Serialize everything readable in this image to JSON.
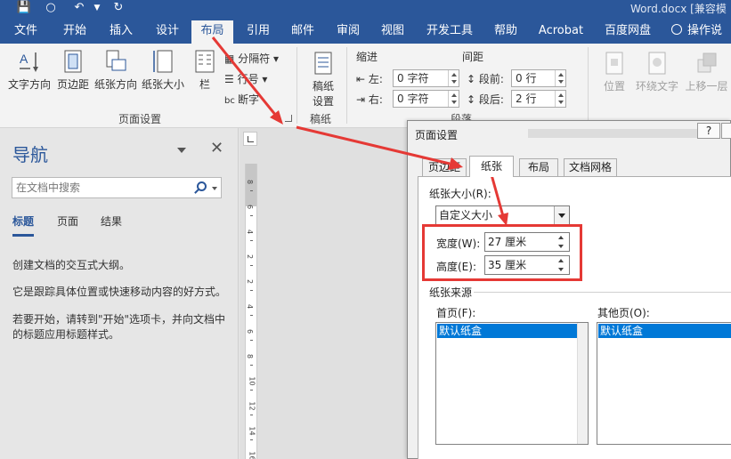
{
  "titlebar": {
    "doc_title": "Word.docx [兼容模"
  },
  "tabs": [
    {
      "label": "文件"
    },
    {
      "label": "开始"
    },
    {
      "label": "插入"
    },
    {
      "label": "设计"
    },
    {
      "label": "布局"
    },
    {
      "label": "引用"
    },
    {
      "label": "邮件"
    },
    {
      "label": "审阅"
    },
    {
      "label": "视图"
    },
    {
      "label": "开发工具"
    },
    {
      "label": "帮助"
    },
    {
      "label": "Acrobat"
    },
    {
      "label": "百度网盘"
    },
    {
      "label": "操作说明"
    }
  ],
  "ribbon": {
    "page_setup": {
      "text_direction": "文字方向",
      "margins": "页边距",
      "orientation": "纸张方向",
      "size": "纸张大小",
      "columns": "栏",
      "breaks": "分隔符",
      "line_numbers": "行号",
      "hyphenation": "断字",
      "group_label": "页面设置"
    },
    "draft": {
      "draft_setup_1": "稿纸",
      "draft_setup_2": "设置",
      "group_label": "稿纸"
    },
    "paragraph": {
      "indent_label": "缩进",
      "spacing_label": "间距",
      "left": "左:",
      "right": "右:",
      "left_value": "0 字符",
      "right_value": "0 字符",
      "before": "段前:",
      "after": "段后:",
      "before_value": "0 行",
      "after_value": "2 行",
      "group_label": "段落"
    },
    "arrange": {
      "position": "位置",
      "wrap_text": "环绕文字",
      "bring_forward": "上移一层"
    }
  },
  "nav": {
    "title": "导航",
    "search_placeholder": "在文档中搜索",
    "tabs": [
      "标题",
      "页面",
      "结果"
    ],
    "text1": "创建文档的交互式大纲。",
    "text2": "它是跟踪具体位置或快速移动内容的好方式。",
    "text3": "若要开始，请转到\"开始\"选项卡，并向文档中的标题应用标题样式。"
  },
  "ruler": {
    "numbers": [
      "8",
      "6",
      "4",
      "2",
      "2",
      "4",
      "6",
      "8",
      "10",
      "12",
      "14",
      "16"
    ]
  },
  "dialog": {
    "title": "页面设置",
    "help": "?",
    "tabs": [
      "页边距",
      "纸张",
      "布局",
      "文档网格"
    ],
    "paper_size_label": "纸张大小(R):",
    "paper_size_value": "自定义大小",
    "width_label": "宽度(W):",
    "width_value": "27 厘米",
    "height_label": "高度(E):",
    "height_value": "35 厘米",
    "paper_source_label": "纸张来源",
    "first_page_label": "首页(F):",
    "other_pages_label": "其他页(O):",
    "first_page_selected": "默认纸盒",
    "other_pages_selected": "默认纸盒"
  },
  "colors": {
    "accent": "#2b579a",
    "annotation": "#e53935",
    "selection": "#0078d7"
  }
}
